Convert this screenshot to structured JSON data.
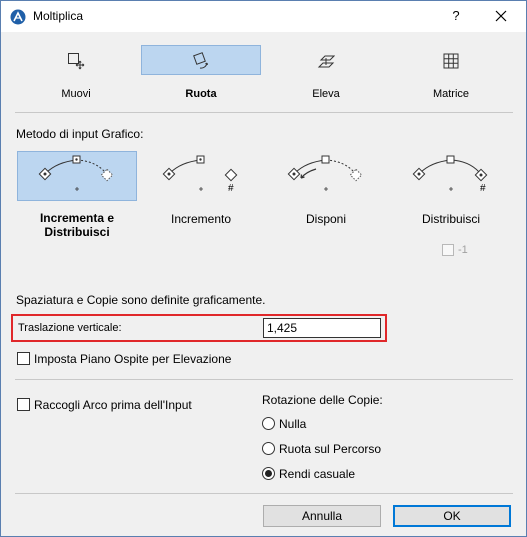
{
  "window": {
    "title": "Moltiplica",
    "help": "?"
  },
  "tabs": [
    {
      "label": "Muovi",
      "icon": "move-icon",
      "selected": false
    },
    {
      "label": "Ruota",
      "icon": "rotate-icon",
      "selected": true
    },
    {
      "label": "Eleva",
      "icon": "elevate-icon",
      "selected": false
    },
    {
      "label": "Matrice",
      "icon": "matrix-icon",
      "selected": false
    }
  ],
  "input_method": {
    "label": "Metodo di input Grafico:",
    "options": [
      {
        "label": "Incrementa e Distribuisci",
        "selected": true
      },
      {
        "label": "Incremento",
        "selected": false
      },
      {
        "label": "Disponi",
        "selected": false
      },
      {
        "label": "Distribuisci",
        "selected": false
      }
    ],
    "extra_checkbox_label": "-1"
  },
  "spacing_text": "Spaziatura e Copie sono definite graficamente.",
  "vertical_offset": {
    "label": "Traslazione verticale:",
    "value": "1,425"
  },
  "host_plane_checkbox": {
    "label": "Imposta Piano Ospite per Elevazione",
    "checked": false
  },
  "collect_arc_checkbox": {
    "label": "Raccogli Arco prima dell'Input",
    "checked": false
  },
  "rotation": {
    "label": "Rotazione delle Copie:",
    "options": [
      {
        "label": "Nulla",
        "checked": false
      },
      {
        "label": "Ruota sul Percorso",
        "checked": false
      },
      {
        "label": "Rendi casuale",
        "checked": true
      }
    ]
  },
  "buttons": {
    "cancel": "Annulla",
    "ok": "OK"
  },
  "colors": {
    "selection_bg": "#bcd6f0",
    "highlight_border": "#e0272a",
    "primary_border": "#0078d7"
  }
}
